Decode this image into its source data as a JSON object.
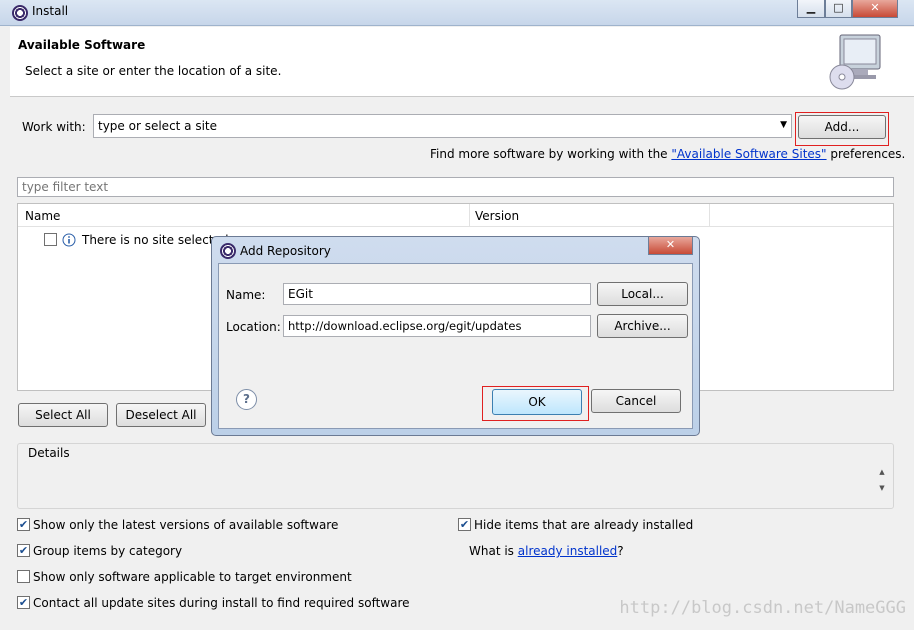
{
  "window": {
    "title": "Install",
    "minimize": "▁",
    "maximize": "□",
    "close": "✕"
  },
  "header": {
    "title": "Available Software",
    "subtitle": "Select a site or enter the location of a site."
  },
  "work_with": {
    "label": "Work with:",
    "value": "type or select a site",
    "add_button": "Add..."
  },
  "find_more": {
    "prefix": "Find more software by working with the ",
    "link": "\"Available Software Sites\"",
    "suffix": " preferences."
  },
  "filter": {
    "placeholder": "type filter text"
  },
  "table": {
    "columns": [
      "Name",
      "Version"
    ],
    "rows": [
      {
        "text": "There is no site selected."
      }
    ]
  },
  "buttons": {
    "select_all": "Select All",
    "deselect_all": "Deselect All"
  },
  "details": {
    "label": "Details"
  },
  "options": {
    "show_latest": {
      "label": "Show only the latest versions of available software",
      "checked": true
    },
    "group_by_category": {
      "label": "Group items by category",
      "checked": true
    },
    "applicable_target": {
      "label": "Show only software applicable to target environment",
      "checked": false
    },
    "contact_sites": {
      "label": "Contact all update sites during install to find required software",
      "checked": true
    },
    "hide_installed": {
      "label": "Hide items that are already installed",
      "checked": true
    },
    "what_is": {
      "prefix": "What is ",
      "link": "already installed",
      "suffix": "?"
    }
  },
  "dialog": {
    "title": "Add Repository",
    "name_label": "Name:",
    "name_value": "EGit",
    "location_label": "Location:",
    "location_value": "http://download.eclipse.org/egit/updates",
    "local_button": "Local...",
    "archive_button": "Archive...",
    "ok_button": "OK",
    "cancel_button": "Cancel",
    "help_icon": "?"
  },
  "watermark": "http://blog.csdn.net/NameGGG"
}
